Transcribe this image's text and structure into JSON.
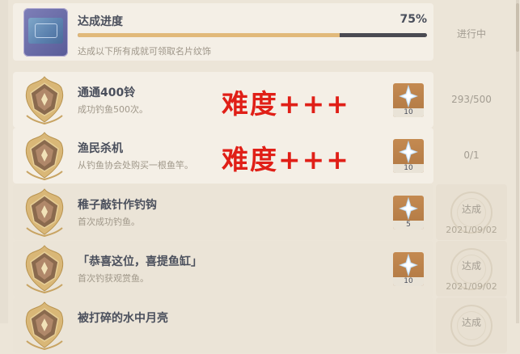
{
  "progress": {
    "title": "达成进度",
    "percent_label": "75%",
    "fraction": 0.75,
    "subtitle": "达成以下所有成就可领取名片纹饰",
    "status": "进行中",
    "namecard_icon": "namecard-icon"
  },
  "achievements": [
    {
      "title": "通通400铃",
      "desc": "成功钓鱼500次。",
      "annotation": "难度+++",
      "reward_count": "10",
      "status": "293/500",
      "date": ""
    },
    {
      "title": "渔民杀机",
      "desc": "从钓鱼协会处购买一根鱼竿。",
      "annotation": "难度+++",
      "reward_count": "10",
      "status": "0/1",
      "date": ""
    },
    {
      "title": "稚子敲针作钓钩",
      "desc": "首次成功钓鱼。",
      "annotation": "",
      "reward_count": "5",
      "status": "达成",
      "date": "2021/09/02"
    },
    {
      "title": "「恭喜这位，喜提鱼缸」",
      "desc": "首次钓获观赏鱼。",
      "annotation": "",
      "reward_count": "10",
      "status": "达成",
      "date": "2021/09/02"
    },
    {
      "title": "被打碎的水中月亮",
      "desc": "",
      "annotation": "",
      "reward_count": "",
      "status": "达成",
      "date": ""
    }
  ],
  "icons": {
    "emblem": "achievement-emblem-icon",
    "reward": "primogem-icon",
    "stamp": "completed-stamp-icon"
  },
  "colors": {
    "accent": "#e1b97a",
    "annotation": "#e01f17",
    "title": "#4a4f5c"
  }
}
